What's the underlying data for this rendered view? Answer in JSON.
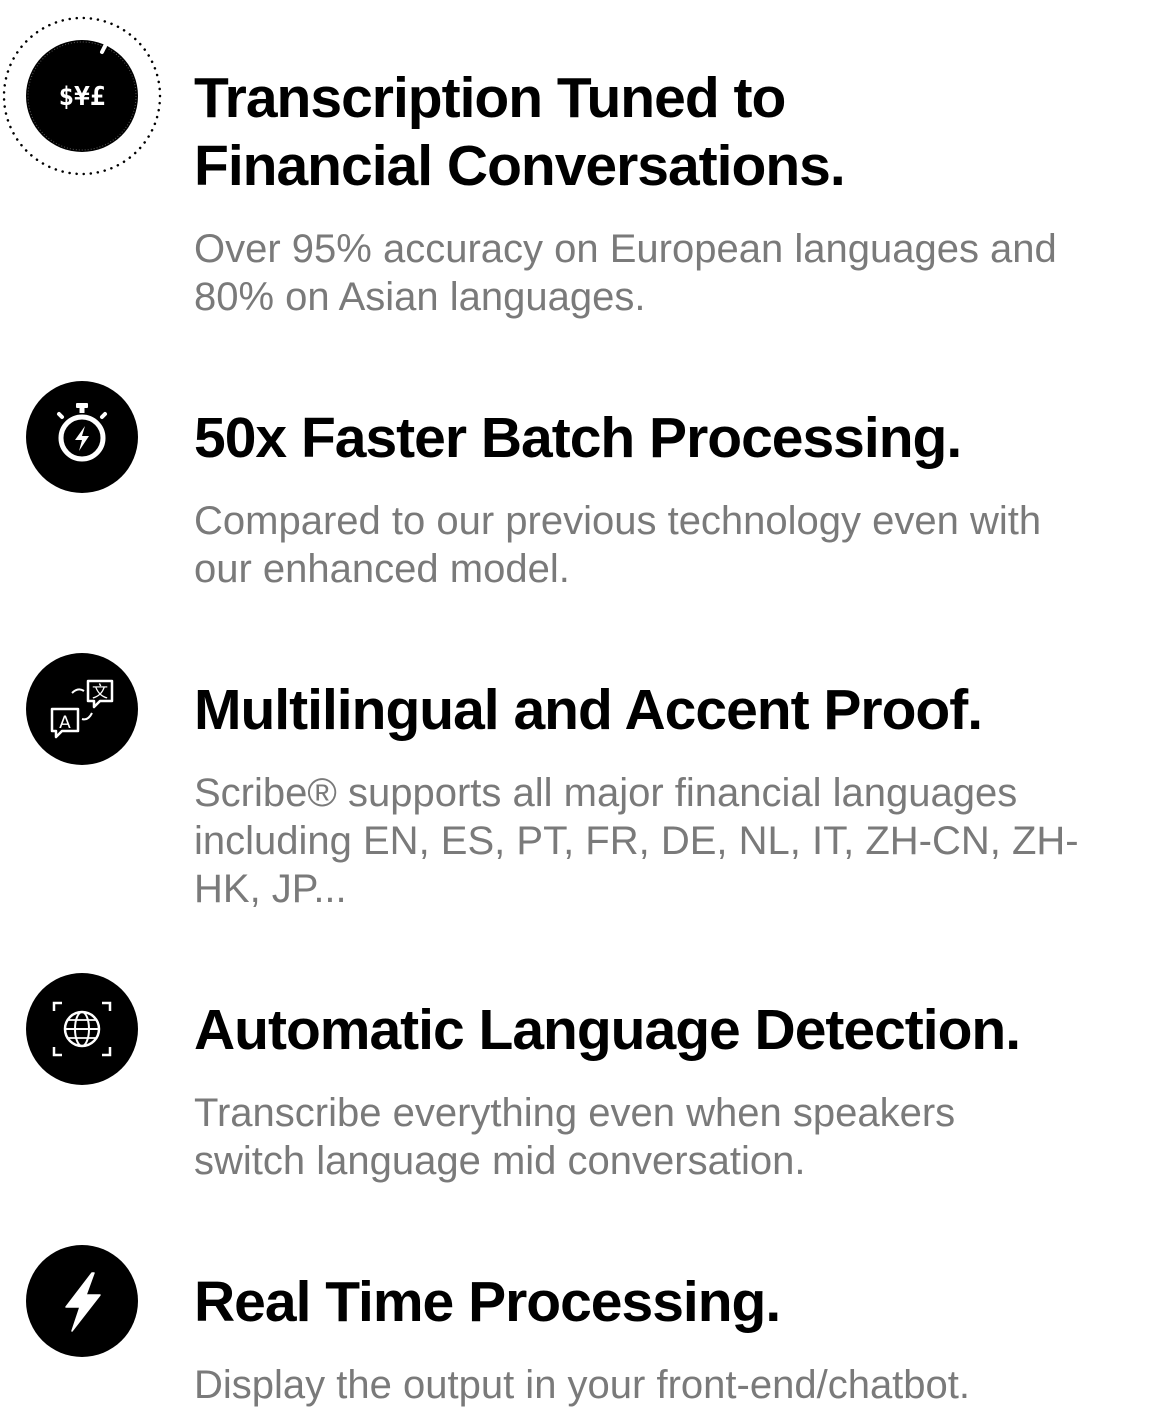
{
  "features": [
    {
      "icon": "currency-icon",
      "icon_text": "$¥£",
      "title_line1": "Transcription Tuned to",
      "title_line2": "Financial Conversations.",
      "desc_line1": "Over 95% accuracy on European languages and",
      "desc_line2": "80% on Asian languages."
    },
    {
      "icon": "stopwatch-icon",
      "title": "50x Faster Batch Processing.",
      "desc_line1": "Compared to our previous technology even with",
      "desc_line2": "our enhanced model."
    },
    {
      "icon": "translate-icon",
      "icon_text_a": "A",
      "icon_text_b": "文",
      "title": "Multilingual and Accent Proof.",
      "desc_line1": "Scribe® supports all major financial languages",
      "desc_line2": "including EN, ES, PT, FR, DE, NL, IT, ZH-CN, ZH-",
      "desc_line3": "HK, JP..."
    },
    {
      "icon": "globe-scan-icon",
      "title": "Automatic Language Detection.",
      "desc_line1": "Transcribe everything even when speakers",
      "desc_line2": "switch language mid conversation."
    },
    {
      "icon": "lightning-icon",
      "title": "Real Time Processing.",
      "desc_line1": "Display the output in your front-end/chatbot."
    }
  ]
}
